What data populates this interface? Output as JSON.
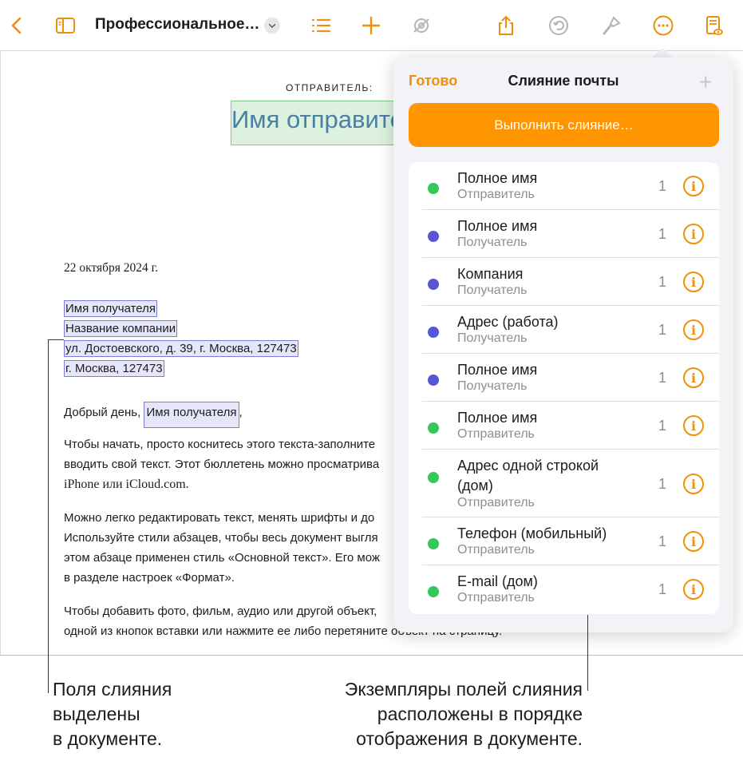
{
  "toolbar": {
    "doc_title": "Профессиональное…",
    "icons": [
      "back-chevron-icon",
      "sidebar-icon",
      "list-icon",
      "plus-icon",
      "collaborate-icon",
      "share-icon",
      "undo-icon",
      "brush-icon",
      "more-icon",
      "reader-view-icon"
    ]
  },
  "document": {
    "sender_label": "ОТПРАВИТЕЛЬ:",
    "sender_name": "Имя отправите",
    "date": "22 октября 2024 г.",
    "recipient_name": "Имя получателя",
    "company": "Название компании",
    "address1": "ул. Достоевского, д. 39, г. Москва, 127473",
    "address2": "г. Москва, 127473",
    "greeting_prefix": "Добрый день,",
    "greeting_field": "Имя получателя",
    "greeting_suffix": ",",
    "p1_l1": "Чтобы начать, просто коснитесь этого текста-заполните",
    "p1_l2": "вводить свой текст. Этот бюллетень можно просматрива",
    "p1_l3": "iPhone или iCloud.com.",
    "p2_l1": "Можно легко редактировать текст, менять шрифты и до",
    "p2_l2": "Используйте стили абзацев, чтобы весь документ выгля",
    "p2_l3": "этом абзаце применен стиль «Основной текст». Его мож",
    "p2_l4": "в разделе настроек «Формат».",
    "p3_l1": "Чтобы добавить фото, фильм, аудио или другой объект,",
    "p3_l2": "одной из кнопок вставки или нажмите ее либо перетяните объект на страницу."
  },
  "popover": {
    "done": "Готово",
    "title": "Слияние почты",
    "add": "+",
    "merge_button": "Выполнить слияние…",
    "rows": [
      {
        "title": "Полное имя",
        "sub": "Отправитель",
        "count": "1",
        "color": "#34c759"
      },
      {
        "title": "Полное имя",
        "sub": "Получатель",
        "count": "1",
        "color": "#5856d6"
      },
      {
        "title": "Компания",
        "sub": "Получатель",
        "count": "1",
        "color": "#5856d6"
      },
      {
        "title": "Адрес (работа)",
        "sub": "Получатель",
        "count": "1",
        "color": "#5856d6"
      },
      {
        "title": "Полное имя",
        "sub": "Получатель",
        "count": "1",
        "color": "#5856d6"
      },
      {
        "title": "Полное имя",
        "sub": "Отправитель",
        "count": "1",
        "color": "#34c759"
      },
      {
        "title": "Адрес одной строкой",
        "title2": "(дом)",
        "sub": "Отправитель",
        "count": "1",
        "color": "#34c759"
      },
      {
        "title": "Телефон (мобильный)",
        "sub": "Отправитель",
        "count": "1",
        "color": "#34c759"
      },
      {
        "title": "E-mail (дом)",
        "sub": "Отправитель",
        "count": "1",
        "color": "#34c759"
      }
    ]
  },
  "callouts": {
    "left_l1": "Поля слияния",
    "left_l2": "выделены",
    "left_l3": "в документе.",
    "right_l1": "Экземпляры полей слияния",
    "right_l2": "расположены в порядке",
    "right_l3": "отображения в документе."
  },
  "colors": {
    "accent": "#ff9500",
    "sender": "#34c759",
    "recipient": "#5856d6"
  }
}
